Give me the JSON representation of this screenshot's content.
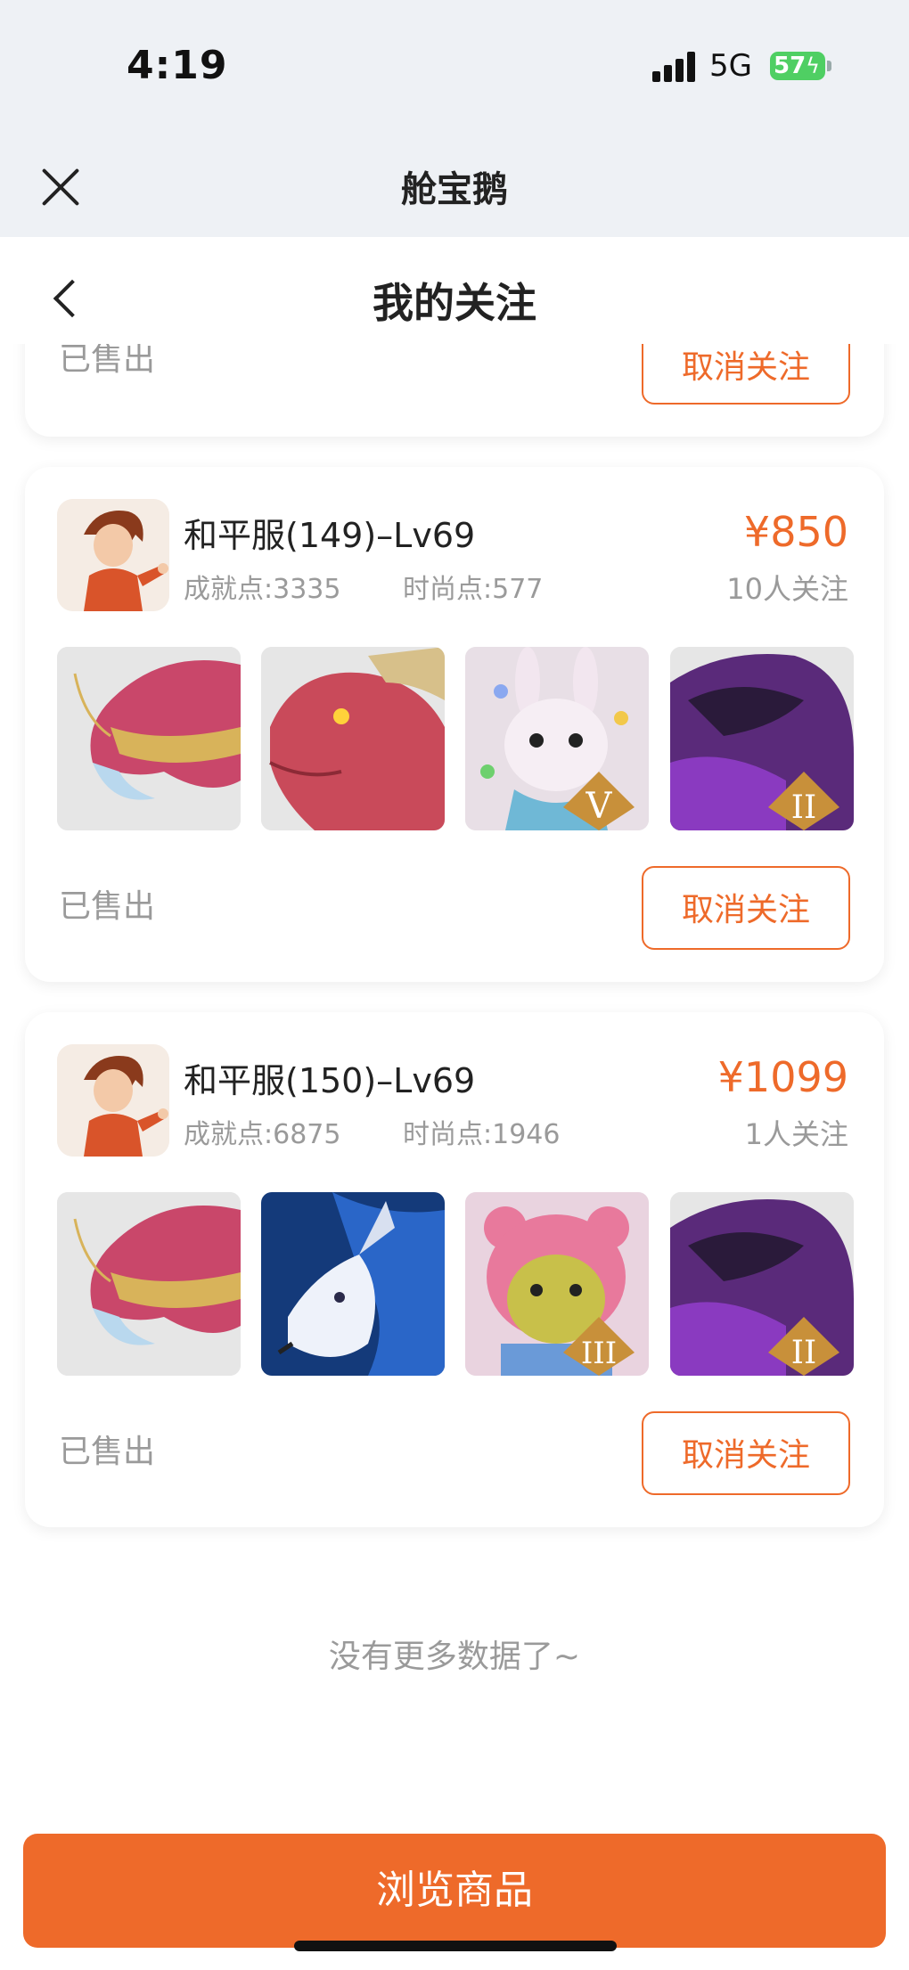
{
  "status_bar": {
    "time": "4:19",
    "network": "5G",
    "battery": "57"
  },
  "mini_program": {
    "title": "舱宝鹅"
  },
  "header": {
    "title": "我的关注"
  },
  "partial_card": {
    "status": "已售出",
    "unfollow_label": "取消关注"
  },
  "items": [
    {
      "name": "和平服(149)–Lv69",
      "achievement": "成就点:3335",
      "fashion": "时尚点:577",
      "price": "¥850",
      "followers": "10人关注",
      "status": "已售出",
      "unfollow_label": "取消关注",
      "thumbs": [
        "pink-dragon-head",
        "red-dragon-head",
        "white-rabbit-rank-V",
        "purple-dragon-rank-II"
      ]
    },
    {
      "name": "和平服(150)–Lv69",
      "achievement": "成就点:6875",
      "fashion": "时尚点:1946",
      "price": "¥1099",
      "followers": "1人关注",
      "status": "已售出",
      "unfollow_label": "取消关注",
      "thumbs": [
        "pink-dragon-head",
        "blue-spirit-deer",
        "pink-bear-rank-III",
        "purple-dragon-rank-II"
      ]
    }
  ],
  "footer": {
    "no_more": "没有更多数据了~",
    "browse_label": "浏览商品"
  },
  "colors": {
    "accent": "#ee6a2a",
    "muted": "#9a9a9a"
  }
}
